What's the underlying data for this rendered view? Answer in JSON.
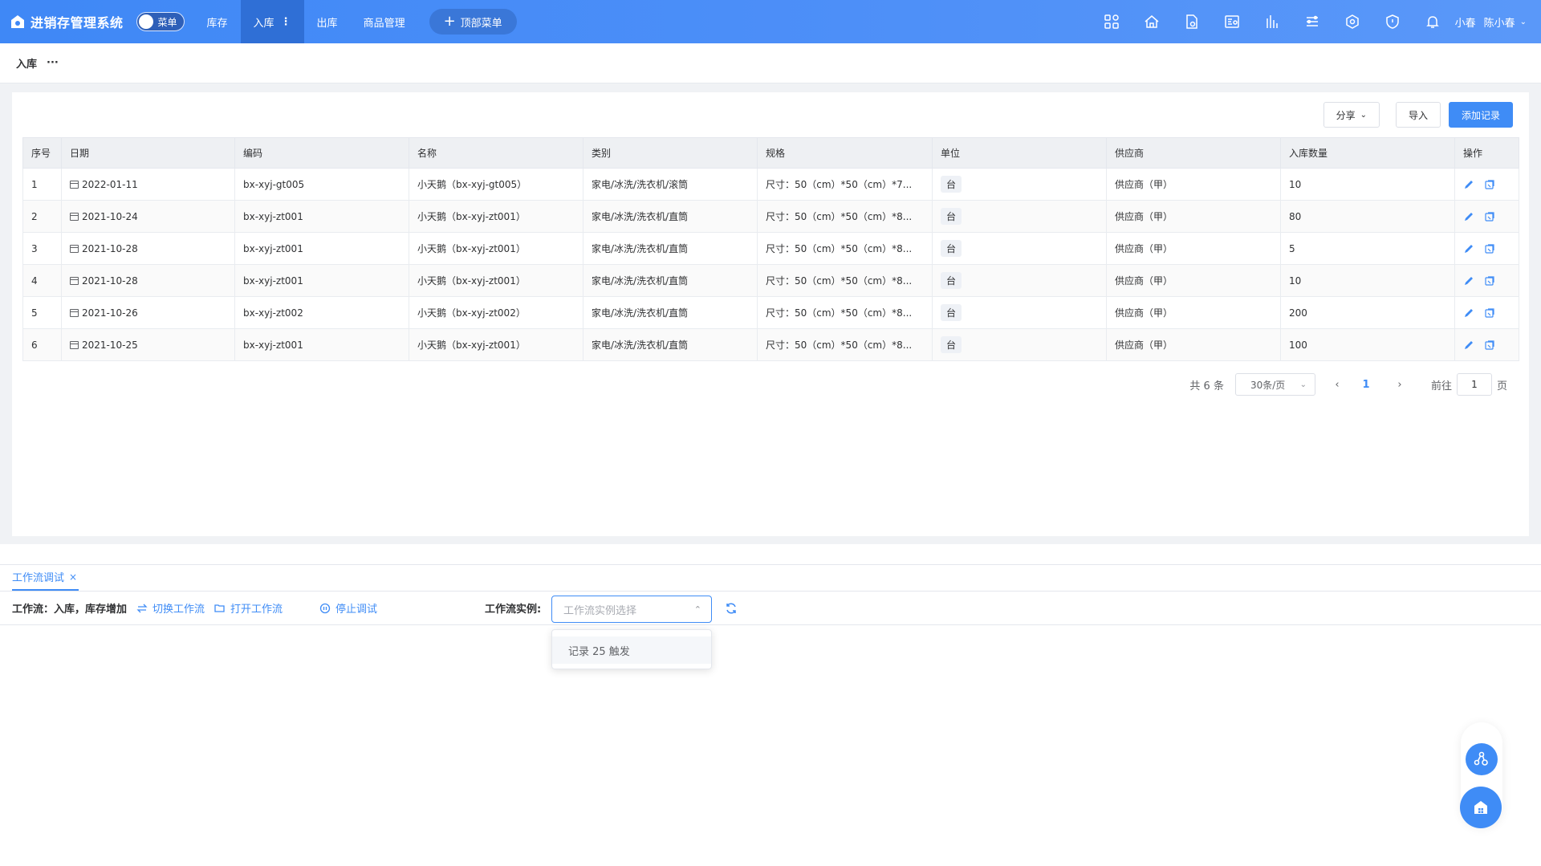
{
  "header": {
    "app_title": "进销存管理系统",
    "toggle_label": "菜单",
    "nav": [
      {
        "label": "库存",
        "active": false
      },
      {
        "label": "入库",
        "active": true
      },
      {
        "label": "出库",
        "active": false
      },
      {
        "label": "商品管理",
        "active": false
      }
    ],
    "nav_more": "⋮",
    "top_menu_button": "顶部菜单",
    "icons": [
      "apps-icon",
      "home-icon",
      "file-settings-icon",
      "report-icon",
      "chart-icon",
      "list-icon",
      "network-icon",
      "shield-icon",
      "bell-icon"
    ],
    "user_short": "小春",
    "user_name": "陈小春",
    "accent": "#3f88f6"
  },
  "breadcrumb": {
    "current": "入库",
    "more": "···"
  },
  "toolbar": {
    "share_label": "分享",
    "import_label": "导入",
    "add_label": "添加记录"
  },
  "table": {
    "headers": [
      "序号",
      "日期",
      "编码",
      "名称",
      "类别",
      "规格",
      "单位",
      "供应商",
      "入库数量",
      "操作"
    ],
    "rows": [
      {
        "no": "1",
        "date": "2022-01-11",
        "code": "bx-xyj-gt005",
        "name": "小天鹅（bx-xyj-gt005）",
        "category": "家电/冰洗/洗衣机/滚筒",
        "spec": "尺寸：50（cm）*50（cm）*7...",
        "unit": "台",
        "supplier": "供应商（甲）",
        "qty": "10"
      },
      {
        "no": "2",
        "date": "2021-10-24",
        "code": "bx-xyj-zt001",
        "name": "小天鹅（bx-xyj-zt001）",
        "category": "家电/冰洗/洗衣机/直筒",
        "spec": "尺寸：50（cm）*50（cm）*8...",
        "unit": "台",
        "supplier": "供应商（甲）",
        "qty": "80"
      },
      {
        "no": "3",
        "date": "2021-10-28",
        "code": "bx-xyj-zt001",
        "name": "小天鹅（bx-xyj-zt001）",
        "category": "家电/冰洗/洗衣机/直筒",
        "spec": "尺寸：50（cm）*50（cm）*8...",
        "unit": "台",
        "supplier": "供应商（甲）",
        "qty": "5"
      },
      {
        "no": "4",
        "date": "2021-10-28",
        "code": "bx-xyj-zt001",
        "name": "小天鹅（bx-xyj-zt001）",
        "category": "家电/冰洗/洗衣机/直筒",
        "spec": "尺寸：50（cm）*50（cm）*8...",
        "unit": "台",
        "supplier": "供应商（甲）",
        "qty": "10"
      },
      {
        "no": "5",
        "date": "2021-10-26",
        "code": "bx-xyj-zt002",
        "name": "小天鹅（bx-xyj-zt002）",
        "category": "家电/冰洗/洗衣机/直筒",
        "spec": "尺寸：50（cm）*50（cm）*8...",
        "unit": "台",
        "supplier": "供应商（甲）",
        "qty": "200"
      },
      {
        "no": "6",
        "date": "2021-10-25",
        "code": "bx-xyj-zt001",
        "name": "小天鹅（bx-xyj-zt001）",
        "category": "家电/冰洗/洗衣机/直筒",
        "spec": "尺寸：50（cm）*50（cm）*8...",
        "unit": "台",
        "supplier": "供应商（甲）",
        "qty": "100"
      }
    ]
  },
  "pagination": {
    "total": "共 6 条",
    "page_size": "30条/页",
    "prev": "‹",
    "current_page": "1",
    "next": "›",
    "goto_prefix": "前往",
    "goto_value": "1",
    "goto_suffix": "页"
  },
  "debug_panel": {
    "tab_label": "工作流调试",
    "tab_close": "×",
    "workflow_label": "工作流：入库，库存增加",
    "switch_label": "切换工作流",
    "open_label": "打开工作流",
    "stop_label": "停止调试",
    "instance_label": "工作流实例:",
    "instance_placeholder": "工作流实例选择",
    "instance_options": [
      "记录 25 触发"
    ]
  }
}
